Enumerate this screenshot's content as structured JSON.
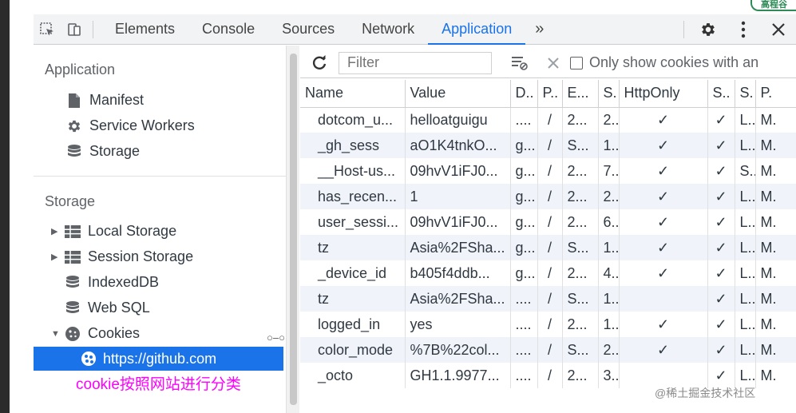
{
  "tabs": [
    "Elements",
    "Console",
    "Sources",
    "Network",
    "Application"
  ],
  "active_tab": "Application",
  "more_tabs_glyph": "»",
  "logo_text": "高程谷",
  "sidebar": {
    "application_heading": "Application",
    "application_items": [
      {
        "label": "Manifest",
        "icon": "document-icon"
      },
      {
        "label": "Service Workers",
        "icon": "gear-icon"
      },
      {
        "label": "Storage",
        "icon": "database-icon"
      }
    ],
    "storage_heading": "Storage",
    "storage_items": [
      {
        "label": "Local Storage",
        "icon": "grid-icon",
        "expandable": true
      },
      {
        "label": "Session Storage",
        "icon": "grid-icon",
        "expandable": true
      },
      {
        "label": "IndexedDB",
        "icon": "database-icon",
        "expandable": false
      },
      {
        "label": "Web SQL",
        "icon": "database-icon",
        "expandable": false
      },
      {
        "label": "Cookies",
        "icon": "cookie-icon",
        "expandable": true,
        "expanded": true
      }
    ],
    "selected_origin": "https://github.com"
  },
  "annotation": "cookie按照网站进行分类",
  "cookies_toolbar": {
    "filter_placeholder": "Filter",
    "only_show_label": "Only show cookies with an"
  },
  "table": {
    "columns": [
      "Name",
      "Value",
      "D..",
      "P..",
      "E...",
      "S.",
      "HttpOnly",
      "S..",
      "S.",
      "P."
    ],
    "rows": [
      [
        "dotcom_u...",
        "helloatguigu",
        "....",
        "/",
        "2...",
        "2..",
        "✓",
        "✓",
        "L..",
        "M."
      ],
      [
        "_gh_sess",
        "aO1K4tnkO...",
        "g...",
        "/",
        "S...",
        "1..",
        "✓",
        "✓",
        "L..",
        "M."
      ],
      [
        "__Host-us...",
        "09hvV1iFJ0...",
        "g...",
        "/",
        "2...",
        "7..",
        "✓",
        "✓",
        "S..",
        "M."
      ],
      [
        "has_recen...",
        "1",
        "g...",
        "/",
        "2...",
        "2..",
        "✓",
        "✓",
        "L..",
        "M."
      ],
      [
        "user_sessi...",
        "09hvV1iFJ0...",
        "g...",
        "/",
        "2...",
        "6..",
        "✓",
        "✓",
        "L..",
        "M."
      ],
      [
        "tz",
        "Asia%2FSha...",
        "g...",
        "/",
        "S...",
        "1..",
        "✓",
        "✓",
        "L..",
        "M."
      ],
      [
        "_device_id",
        "b405f4ddb...",
        "g...",
        "/",
        "2...",
        "4..",
        "✓",
        "✓",
        "L..",
        "M."
      ],
      [
        "tz",
        "Asia%2FSha...",
        "....",
        "/",
        "S...",
        "1..",
        "",
        "✓",
        "L..",
        "M."
      ],
      [
        "logged_in",
        "yes",
        "....",
        "/",
        "2...",
        "1..",
        "✓",
        "✓",
        "L..",
        "M."
      ],
      [
        "color_mode",
        "%7B%22col...",
        "....",
        "/",
        "S...",
        "2..",
        "✓",
        "✓",
        "L..",
        "M."
      ],
      [
        "_octo",
        "GH1.1.9977...",
        "....",
        "/",
        "2...",
        "3..",
        "",
        "✓",
        "L..",
        "M."
      ]
    ]
  },
  "watermark": "@稀土掘金技术社区",
  "colors": {
    "accent": "#1a73e8",
    "annotation": "#ff00ff",
    "row_alt": "#f0f4fa"
  }
}
